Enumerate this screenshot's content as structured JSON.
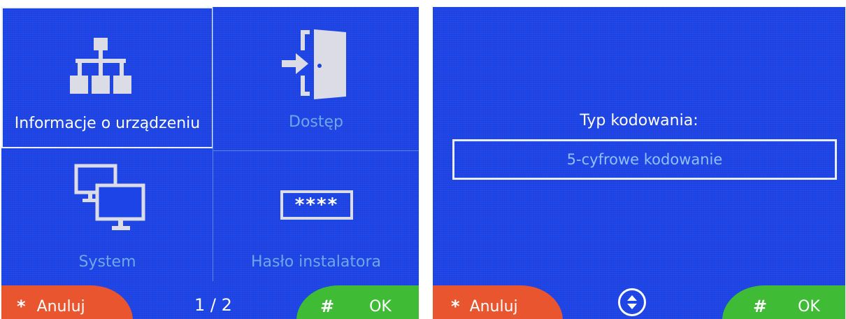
{
  "left_screen": {
    "menu": {
      "info_label": "Informacje o urządzeniu",
      "access_label": "Dostęp",
      "system_label": "System",
      "installer_password_label": "Hasło instalatora",
      "password_mask": "****"
    },
    "footer": {
      "cancel_key": "*",
      "cancel_label": "Anuluj",
      "page_indicator": "1 / 2",
      "ok_key": "#",
      "ok_label": "OK"
    }
  },
  "right_screen": {
    "title": "Typ kodowania:",
    "selected_value": "5-cyfrowe kodowanie",
    "footer": {
      "cancel_key": "*",
      "cancel_label": "Anuluj",
      "ok_key": "#",
      "ok_label": "OK"
    }
  },
  "colors": {
    "screen_bg": "#1d44e6",
    "cancel": "#e8552e",
    "ok": "#3fbb35",
    "dim_label": "#6fa8e8"
  },
  "icons": [
    "network-tree-icon",
    "door-enter-icon",
    "computers-icon",
    "password-field-icon",
    "up-down-arrows-icon"
  ]
}
